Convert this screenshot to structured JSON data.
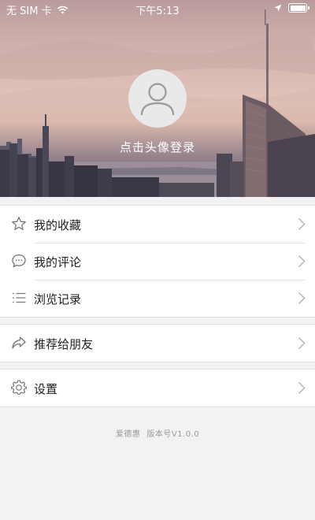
{
  "status_bar": {
    "carrier": "无 SIM 卡",
    "time": "下午5:13"
  },
  "profile": {
    "login_prompt": "点击头像登录"
  },
  "menu_groups": [
    {
      "items": [
        {
          "label": "我的收藏",
          "icon": "star-icon"
        },
        {
          "label": "我的评论",
          "icon": "comment-icon"
        },
        {
          "label": "浏览记录",
          "icon": "list-icon"
        }
      ]
    },
    {
      "items": [
        {
          "label": "推荐给朋友",
          "icon": "share-icon"
        }
      ]
    },
    {
      "items": [
        {
          "label": "设置",
          "icon": "gear-icon"
        }
      ]
    }
  ],
  "footer": {
    "app_name": "爱德惠",
    "version": "版本号V1.0.0"
  },
  "colors": {
    "background": "#f2f2f2",
    "icon": "#777777",
    "chevron": "#b5b5b5"
  }
}
